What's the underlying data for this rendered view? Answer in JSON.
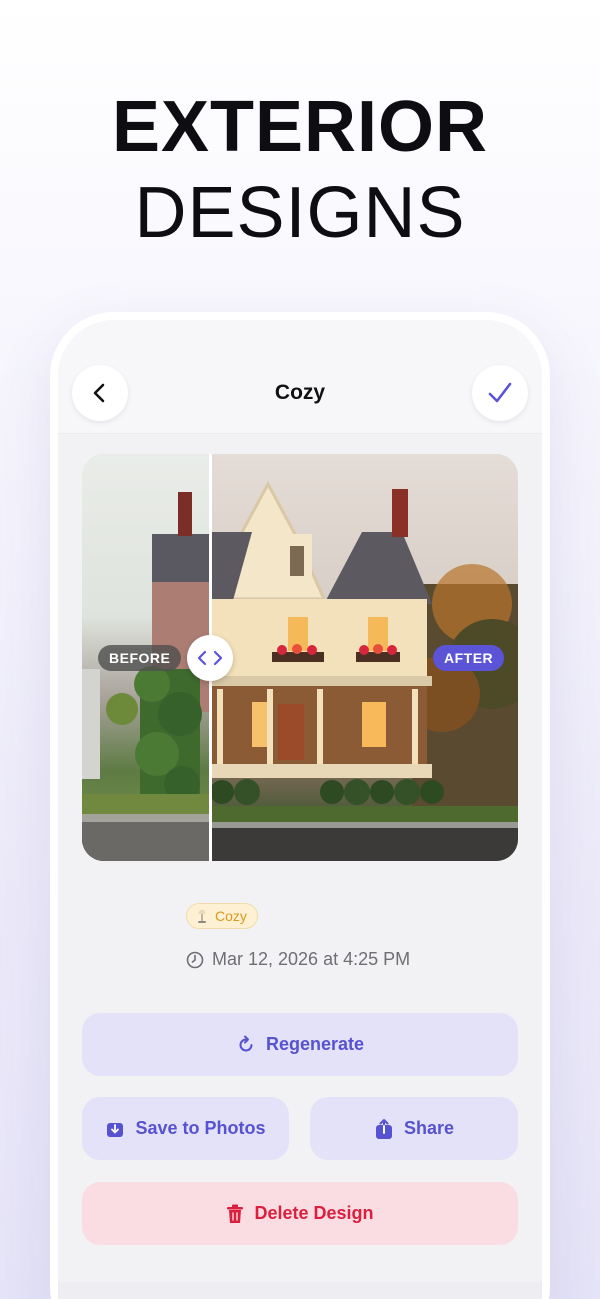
{
  "headline": {
    "line1": "EXTERIOR",
    "line2": "DESIGNS"
  },
  "navbar": {
    "title": "Cozy",
    "back_icon": "chevron-left-icon",
    "confirm_icon": "checkmark-icon"
  },
  "compare": {
    "before_label": "BEFORE",
    "after_label": "AFTER",
    "handle_icon": "left-right-arrows-icon",
    "split_fraction": 0.29
  },
  "details": {
    "style_tag": "Cozy",
    "timestamp": "Mar 12, 2026 at 4:25 PM"
  },
  "actions": {
    "regenerate": "Regenerate",
    "save": "Save to Photos",
    "share": "Share",
    "delete": "Delete Design"
  },
  "colors": {
    "accent": "#5b54d6",
    "accent_soft": "#e3e2f8",
    "danger": "#dc1f3e",
    "danger_soft": "#f9dde3",
    "tag_text": "#d99a1e",
    "tag_bg": "#fdf0d3"
  }
}
